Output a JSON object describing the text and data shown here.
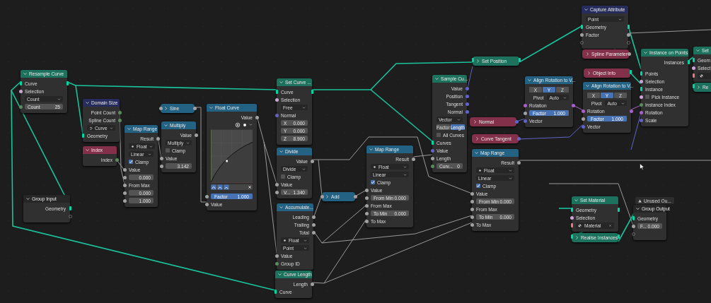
{
  "editor": {
    "nodes": [
      {
        "title": "Resample Curve",
        "collapsed": false,
        "rows": [
          {
            "kind": "socket",
            "label": "Curve"
          },
          {
            "kind": "socket",
            "label": "Selection"
          },
          {
            "kind": "dropdown",
            "value": "Count"
          },
          {
            "kind": "field",
            "label": "Count",
            "value": "25"
          }
        ]
      },
      {
        "title": "Domain Size",
        "collapsed": false,
        "rows": [
          {
            "kind": "socket",
            "label": "Point Count"
          },
          {
            "kind": "socket",
            "label": "Spline Count"
          },
          {
            "kind": "dropdown",
            "value": "Curve"
          },
          {
            "kind": "socket",
            "label": "Geometry"
          }
        ]
      },
      {
        "title": "Index",
        "collapsed": false,
        "rows": [
          {
            "kind": "socket",
            "label": "Index"
          }
        ]
      },
      {
        "title": "Group Input",
        "collapsed": false,
        "rows": [
          {
            "kind": "socket",
            "label": "Geometry"
          },
          {
            "kind": "socket"
          }
        ]
      },
      {
        "title": "Map Range",
        "collapsed": false,
        "rows": [
          {
            "kind": "socket",
            "label": "Result"
          },
          {
            "kind": "dropdown",
            "value": "Float"
          },
          {
            "kind": "dropdown",
            "value": "Linear"
          },
          {
            "kind": "check",
            "label": "Clamp",
            "checked": true
          },
          {
            "kind": "socket",
            "label": "Value"
          },
          {
            "kind": "field",
            "value": "0.000"
          },
          {
            "kind": "socket",
            "label": "From Max"
          },
          {
            "kind": "field",
            "value": "0.000"
          },
          {
            "kind": "field",
            "value": "1.000"
          }
        ]
      },
      {
        "title": "Sine",
        "collapsed": true
      },
      {
        "title": "Multiply",
        "collapsed": false,
        "rows": [
          {
            "kind": "socket",
            "label": "Value"
          },
          {
            "kind": "dropdown",
            "value": "Multiply"
          },
          {
            "kind": "check",
            "label": "Clamp",
            "checked": false
          },
          {
            "kind": "socket",
            "label": "Value"
          },
          {
            "kind": "field",
            "value": "3.142"
          }
        ]
      },
      {
        "title": "Float Curve",
        "collapsed": false,
        "rows": [
          {
            "kind": "socket",
            "label": "Value"
          },
          {
            "kind": "curve"
          },
          {
            "kind": "slider",
            "label": "Factor",
            "value": "1.000",
            "level": 1
          },
          {
            "kind": "socket",
            "label": "Value"
          }
        ]
      },
      {
        "title": "Set Curve ...",
        "collapsed": false,
        "rows": [
          {
            "kind": "socket",
            "label": "Curve"
          },
          {
            "kind": "socket",
            "label": "Selection"
          },
          {
            "kind": "dropdown",
            "value": "Free"
          },
          {
            "kind": "socket",
            "label": "Normal"
          },
          {
            "kind": "field",
            "label": "X",
            "value": "0.000"
          },
          {
            "kind": "field",
            "label": "Y",
            "value": "0.000"
          },
          {
            "kind": "field",
            "label": "Z",
            "value": "8.900"
          }
        ]
      },
      {
        "title": "Divide",
        "collapsed": false,
        "rows": [
          {
            "kind": "socket",
            "label": "Value"
          },
          {
            "kind": "dropdown",
            "value": "Divide"
          },
          {
            "kind": "check",
            "label": "Clamp",
            "checked": false
          },
          {
            "kind": "socket",
            "label": "Value"
          },
          {
            "kind": "field",
            "label": "V...",
            "value": "1.340"
          }
        ]
      },
      {
        "title": "Accumulate...",
        "collapsed": false,
        "rows": [
          {
            "kind": "socket",
            "label": "Leading"
          },
          {
            "kind": "socket",
            "label": "Trailing"
          },
          {
            "kind": "socket",
            "label": "Total"
          },
          {
            "kind": "dropdown",
            "value": "Float"
          },
          {
            "kind": "dropdown",
            "value": "Point"
          },
          {
            "kind": "socket",
            "label": "Value"
          },
          {
            "kind": "socket",
            "label": "Group ID"
          }
        ]
      },
      {
        "title": "Curve Length",
        "collapsed": false,
        "rows": [
          {
            "kind": "socket",
            "label": "Length"
          },
          {
            "kind": "socket",
            "label": "Curve"
          }
        ]
      },
      {
        "title": "Add",
        "collapsed": true
      },
      {
        "title": "Map Range",
        "collapsed": false,
        "rows": [
          {
            "kind": "socket",
            "label": "Result"
          },
          {
            "kind": "dropdown",
            "value": "Float"
          },
          {
            "kind": "dropdown",
            "value": "Linear"
          },
          {
            "kind": "check",
            "label": "Clamp",
            "checked": true
          },
          {
            "kind": "socket",
            "label": "Value"
          },
          {
            "kind": "field",
            "label": "From Min",
            "value": "0.000"
          },
          {
            "kind": "socket",
            "label": "From Max"
          },
          {
            "kind": "field",
            "label": "To Min",
            "value": "0.000"
          },
          {
            "kind": "socket",
            "label": "To Max"
          }
        ]
      },
      {
        "title": "Sample Cu...",
        "collapsed": false,
        "rows": [
          {
            "kind": "socket",
            "label": "Value"
          },
          {
            "kind": "socket",
            "label": "Position"
          },
          {
            "kind": "socket",
            "label": "Tangent"
          },
          {
            "kind": "socket",
            "label": "Normal"
          },
          {
            "kind": "dropdown",
            "value": "Vector"
          },
          {
            "kind": "toggle",
            "options": [
              {
                "label": "Factor",
                "selected": false
              },
              {
                "label": "Length",
                "selected": true
              }
            ]
          },
          {
            "kind": "check",
            "label": "All Curves",
            "checked": false
          },
          {
            "kind": "socket",
            "label": "Curves"
          },
          {
            "kind": "socket",
            "label": "Value"
          },
          {
            "kind": "socket",
            "label": "Length"
          },
          {
            "kind": "field",
            "label": "Curv...",
            "value": "0"
          }
        ]
      },
      {
        "title": "Set Position",
        "collapsed": true
      },
      {
        "title": "Normal",
        "collapsed": true
      },
      {
        "title": "Curve Tangent",
        "collapsed": true
      },
      {
        "title": "Map Range",
        "collapsed": false,
        "rows": [
          {
            "kind": "socket",
            "label": "Result"
          },
          {
            "kind": "dropdown",
            "value": "Float"
          },
          {
            "kind": "dropdown",
            "value": "Linear"
          },
          {
            "kind": "check",
            "label": "Clamp",
            "checked": true
          },
          {
            "kind": "socket",
            "label": "Value"
          },
          {
            "kind": "field",
            "label": "From Min",
            "value": "0.000"
          },
          {
            "kind": "socket",
            "label": "From Max"
          },
          {
            "kind": "field",
            "label": "To Min",
            "value": "0.000"
          },
          {
            "kind": "socket",
            "label": "To Max"
          }
        ]
      },
      {
        "title": "Align Rotation to V...",
        "collapsed": false,
        "rows": [
          {
            "kind": "toggle",
            "options": [
              {
                "label": "X",
                "selected": false
              },
              {
                "label": "Y",
                "selected": true
              },
              {
                "label": "Z",
                "selected": false
              }
            ]
          },
          {
            "kind": "prop",
            "label": "Pivot",
            "value": "Auto"
          },
          {
            "kind": "socket",
            "label": "Rotation"
          },
          {
            "kind": "slider",
            "label": "Factor",
            "value": "1.000",
            "level": 1
          },
          {
            "kind": "socket",
            "label": "Vector"
          }
        ]
      },
      {
        "title": "Capture Attribute",
        "collapsed": false,
        "rows": [
          {
            "kind": "dropdown",
            "value": "Point"
          },
          {
            "kind": "socket",
            "label": "Geometry"
          },
          {
            "kind": "socket",
            "label": "Factor"
          },
          {
            "kind": "socket"
          }
        ]
      },
      {
        "title": "Spline Parameter",
        "collapsed": true
      },
      {
        "title": "Object Info",
        "collapsed": true
      },
      {
        "title": "Align Rotation to V...",
        "collapsed": false,
        "rows": [
          {
            "kind": "toggle",
            "options": [
              {
                "label": "X",
                "selected": false
              },
              {
                "label": "Y",
                "selected": true
              },
              {
                "label": "Z",
                "selected": false
              }
            ]
          },
          {
            "kind": "prop",
            "label": "Pivot",
            "value": "Auto"
          },
          {
            "kind": "socket",
            "label": "Rotation"
          },
          {
            "kind": "slider",
            "label": "Factor",
            "value": "1.000",
            "level": 1
          },
          {
            "kind": "socket",
            "label": "Vector"
          }
        ]
      },
      {
        "title": "Instance on Points",
        "collapsed": false,
        "rows": [
          {
            "kind": "socket",
            "label": "Instances"
          },
          {
            "kind": "gap"
          },
          {
            "kind": "socket",
            "label": "Points"
          },
          {
            "kind": "socket",
            "label": "Selection"
          },
          {
            "kind": "socket",
            "label": "Instance"
          },
          {
            "kind": "check",
            "label": "Pick Instance",
            "checked": false
          },
          {
            "kind": "socket",
            "label": "Instance Index"
          },
          {
            "kind": "socket",
            "label": "Rotation"
          },
          {
            "kind": "socket",
            "label": "Scale"
          }
        ]
      },
      {
        "title": "Set",
        "collapsed": false,
        "rows": [
          {
            "kind": "socket",
            "label": "Geom"
          },
          {
            "kind": "socket",
            "label": "Select"
          },
          {
            "kind": "material"
          }
        ]
      },
      {
        "title": "Re",
        "collapsed": true
      },
      {
        "title": "Set Material",
        "collapsed": false,
        "rows": [
          {
            "kind": "socket",
            "label": "Geometry"
          },
          {
            "kind": "socket",
            "label": "Selection"
          },
          {
            "kind": "material",
            "value": "Material"
          }
        ]
      },
      {
        "title": "Realise Instances",
        "collapsed": true
      },
      {
        "title": "Group Output",
        "collapsed": false,
        "warning": "Unused Ou...",
        "rows": [
          {
            "kind": "socket",
            "label": "Geometry"
          },
          {
            "kind": "field",
            "label": "F...",
            "value": "0.000"
          },
          {
            "kind": "socket"
          }
        ]
      }
    ]
  }
}
